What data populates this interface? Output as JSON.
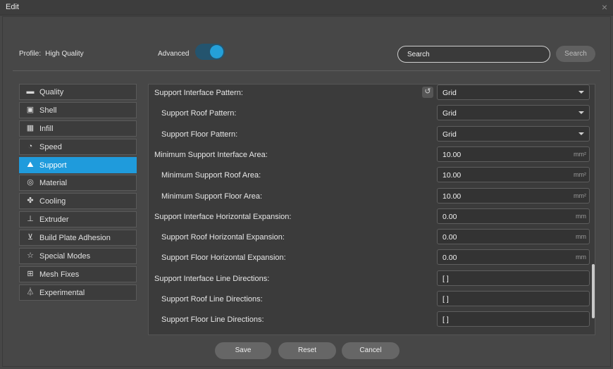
{
  "window": {
    "title": "Edit",
    "close_glyph": "×"
  },
  "header": {
    "profile_label": "Profile:",
    "profile_value": "High Quality",
    "advanced_label": "Advanced",
    "advanced_on": true,
    "search_value": "Search",
    "search_button": "Search"
  },
  "colors": {
    "accent": "#1f9bdc",
    "toggle_track": "#24546e",
    "background": "#474747"
  },
  "sidebar": {
    "items": [
      {
        "label": "Quality",
        "icon": "quality-icon"
      },
      {
        "label": "Shell",
        "icon": "shell-icon"
      },
      {
        "label": "Infill",
        "icon": "infill-icon"
      },
      {
        "label": "Speed",
        "icon": "speed-icon"
      },
      {
        "label": "Support",
        "icon": "support-icon",
        "active": true
      },
      {
        "label": "Material",
        "icon": "material-icon"
      },
      {
        "label": "Cooling",
        "icon": "fan-icon"
      },
      {
        "label": "Extruder",
        "icon": "extruder-icon"
      },
      {
        "label": "Build Plate Adhesion",
        "icon": "build-plate-icon"
      },
      {
        "label": "Special Modes",
        "icon": "star-icon"
      },
      {
        "label": "Mesh Fixes",
        "icon": "mesh-fix-icon"
      },
      {
        "label": "Experimental",
        "icon": "flask-icon"
      }
    ]
  },
  "settings": [
    {
      "label": "Support Interface Pattern:",
      "value": "Grid",
      "type": "dropdown",
      "reset": true
    },
    {
      "label": "Support Roof Pattern:",
      "value": "Grid",
      "type": "dropdown"
    },
    {
      "label": "Support Floor Pattern:",
      "value": "Grid",
      "type": "dropdown"
    },
    {
      "label": "Minimum Support Interface Area:",
      "value": "10.00",
      "unit": "mm²"
    },
    {
      "label": "Minimum Support Roof Area:",
      "value": "10.00",
      "unit": "mm²"
    },
    {
      "label": "Minimum Support Floor Area:",
      "value": "10.00",
      "unit": "mm²"
    },
    {
      "label": "Support Interface Horizontal Expansion:",
      "value": "0.00",
      "unit": "mm"
    },
    {
      "label": "Support Roof Horizontal Expansion:",
      "value": "0.00",
      "unit": "mm"
    },
    {
      "label": "Support Floor Horizontal Expansion:",
      "value": "0.00",
      "unit": "mm"
    },
    {
      "label": "Support Interface Line Directions:",
      "value": "[ ]"
    },
    {
      "label": "Support Roof Line Directions:",
      "value": "[ ]"
    },
    {
      "label": "Support Floor Line Directions:",
      "value": "[ ]"
    }
  ],
  "footer": {
    "save": "Save",
    "reset": "Reset",
    "cancel": "Cancel"
  }
}
